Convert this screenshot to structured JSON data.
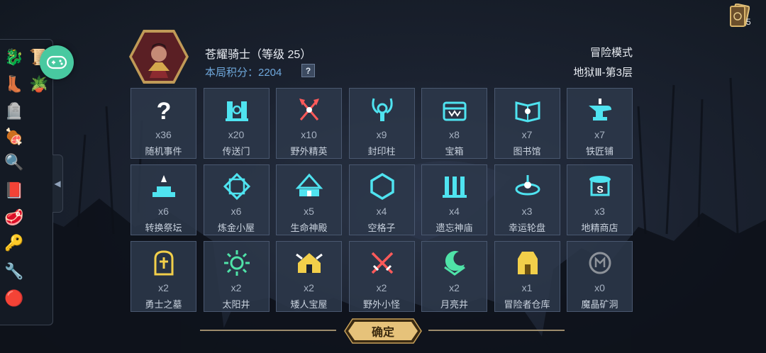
{
  "header": {
    "hero_name": "苍耀骑士（等级 25）",
    "score_label": "本局积分：2204",
    "score_help": "?",
    "mode": "冒险模式",
    "floor": "地狱Ⅲ-第3层"
  },
  "card_counter": {
    "count": "5",
    "icon": "card-deck-icon"
  },
  "sidebar": {
    "items": [
      {
        "icon": "dragon-icon",
        "glyph": "🐉"
      },
      {
        "icon": "scroll-plus-icon",
        "glyph": "📜"
      },
      {
        "icon": "boot-icon",
        "glyph": "👢"
      },
      {
        "icon": "pot-icon",
        "glyph": "🪴"
      },
      {
        "icon": "tombstone-plus-icon",
        "glyph": "🪦"
      },
      {
        "icon": "meat-icon",
        "glyph": "🍖"
      },
      {
        "icon": "magnifier-icon",
        "glyph": "🔍"
      },
      {
        "icon": "spellbook-icon",
        "glyph": "📕"
      },
      {
        "icon": "steak-icon",
        "glyph": "🥩"
      },
      {
        "icon": "key-icon",
        "glyph": "🔑"
      },
      {
        "icon": "pliers-icon",
        "glyph": "🔧"
      },
      {
        "icon": "eye-orb-icon",
        "glyph": "🔴"
      }
    ],
    "toggle_glyph": "◀"
  },
  "tiles": [
    {
      "name": "随机事件",
      "count": "x36",
      "icon": "question-icon",
      "color": "#ffffff"
    },
    {
      "name": "传送门",
      "count": "x20",
      "icon": "portal-icon",
      "color": "#4fe3f0"
    },
    {
      "name": "野外精英",
      "count": "x10",
      "icon": "crossed-axes-icon",
      "color": "#ff5a5a"
    },
    {
      "name": "封印柱",
      "count": "x9",
      "icon": "seal-pillar-icon",
      "color": "#4fe3f0"
    },
    {
      "name": "宝箱",
      "count": "x8",
      "icon": "chest-icon",
      "color": "#4fe3f0"
    },
    {
      "name": "图书馆",
      "count": "x7",
      "icon": "book-icon",
      "color": "#4fe3f0"
    },
    {
      "name": "铁匠铺",
      "count": "x7",
      "icon": "anvil-icon",
      "color": "#4fe3f0"
    },
    {
      "name": "转换祭坛",
      "count": "x6",
      "icon": "altar-icon",
      "color": "#4fe3f0"
    },
    {
      "name": "炼金小屋",
      "count": "x6",
      "icon": "alchemy-icon",
      "color": "#4fe3f0"
    },
    {
      "name": "生命神殿",
      "count": "x5",
      "icon": "temple-icon",
      "color": "#4fe3f0"
    },
    {
      "name": "空格子",
      "count": "x4",
      "icon": "hexagon-icon",
      "color": "#4fe3f0"
    },
    {
      "name": "遗忘神庙",
      "count": "x4",
      "icon": "shrine-icon",
      "color": "#4fe3f0"
    },
    {
      "name": "幸运轮盘",
      "count": "x3",
      "icon": "roulette-icon",
      "color": "#4fe3f0"
    },
    {
      "name": "地精商店",
      "count": "x3",
      "icon": "shop-icon",
      "color": "#4fe3f0"
    },
    {
      "name": "勇士之墓",
      "count": "x2",
      "icon": "tomb-icon",
      "color": "#f2cf4a"
    },
    {
      "name": "太阳井",
      "count": "x2",
      "icon": "sun-well-icon",
      "color": "#4fe3a8"
    },
    {
      "name": "矮人宝屋",
      "count": "x2",
      "icon": "dwarf-house-icon",
      "color": "#f2cf4a"
    },
    {
      "name": "野外小怪",
      "count": "x2",
      "icon": "crossed-swords-icon",
      "color": "#ff5a5a"
    },
    {
      "name": "月亮井",
      "count": "x2",
      "icon": "moon-well-icon",
      "color": "#4fe3a8"
    },
    {
      "name": "冒险者仓库",
      "count": "x1",
      "icon": "warehouse-icon",
      "color": "#f2cf4a"
    },
    {
      "name": "魔晶矿洞",
      "count": "x0",
      "icon": "crystal-mine-icon",
      "color": "#e0e0e0"
    }
  ],
  "confirm": {
    "label": "确定"
  }
}
